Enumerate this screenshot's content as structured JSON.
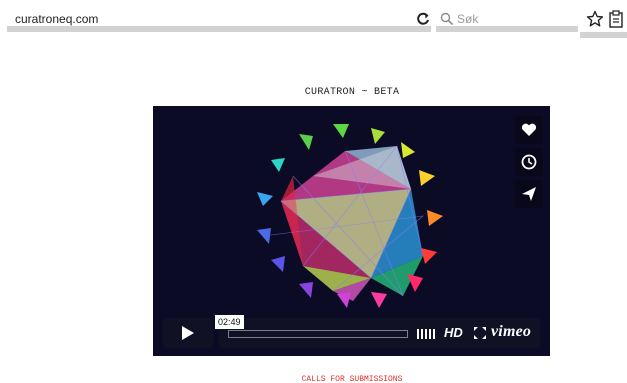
{
  "browser": {
    "url": "curatroneq.com",
    "search_placeholder": "Søk",
    "icons": [
      "reload-icon",
      "search-icon",
      "bookmark-star-icon",
      "clipboard-icon"
    ]
  },
  "page": {
    "title": "CURATRON ~ BETA",
    "calls_link": "CALLS FOR SUBMISSIONS",
    "calls_color": "#e03030"
  },
  "player": {
    "time": "02:49",
    "hd_label": "HD",
    "brand": "vimeo",
    "side_buttons": [
      "heart-icon",
      "clock-icon",
      "send-icon"
    ],
    "background": "#0c0b25"
  }
}
